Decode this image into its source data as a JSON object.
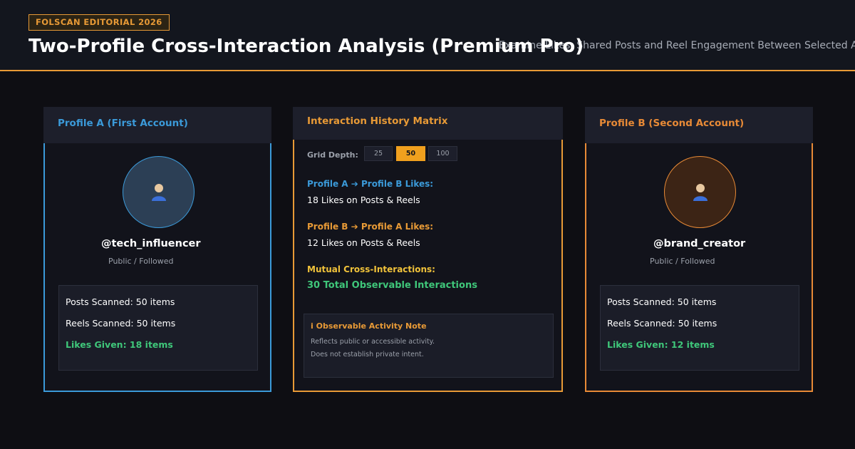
{
  "header": {
    "badge": "FOLSCAN EDITORIAL 2026",
    "title": "Two-Profile Cross-Interaction Analysis (Premium Pro)",
    "subtitle": "Examine Likes, Shared Posts and Reel Engagement Between Selected Accounts"
  },
  "profile_a": {
    "heading": "Profile A (First Account)",
    "avatar_icon": "user-icon",
    "handle": "@tech_influencer",
    "visibility": "Public / Followed",
    "posts_scanned": "Posts Scanned: 50 items",
    "reels_scanned": "Reels Scanned: 50 items",
    "likes_given": "Likes Given: 18 items",
    "accent": "#3b9ad9"
  },
  "matrix": {
    "heading": "Interaction History Matrix",
    "grid_depth_label": "Grid Depth:",
    "grid_depth_options": [
      "25",
      "50",
      "100"
    ],
    "grid_depth_selected": "50",
    "a_to_b_label": "Profile A  ➔  Profile B Likes:",
    "a_to_b_value": "18 Likes on Posts & Reels",
    "b_to_a_label": "Profile B  ➔  Profile A Likes:",
    "b_to_a_value": "12 Likes on Posts & Reels",
    "mutual_label": "Mutual Cross-Interactions:",
    "mutual_value": "30 Total Observable Interactions",
    "note_title": "i Observable Activity Note",
    "note_line1": "Reflects public or accessible activity.",
    "note_line2": "Does not establish private intent.",
    "accent": "#e89a36"
  },
  "profile_b": {
    "heading": "Profile B (Second Account)",
    "avatar_icon": "user-icon",
    "handle": "@brand_creator",
    "visibility": "Public / Followed",
    "posts_scanned": "Posts Scanned: 50 items",
    "reels_scanned": "Reels Scanned: 50 items",
    "likes_given": "Likes Given: 12 items",
    "accent": "#e88a36"
  },
  "colors": {
    "background": "#0e0e13",
    "panel": "#12131b",
    "success": "#3fc77a",
    "highlight": "#f0c23a"
  }
}
